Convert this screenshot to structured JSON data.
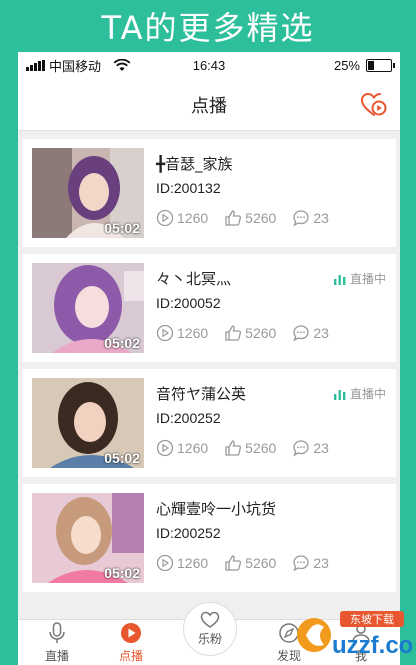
{
  "banner": {
    "text": "TA的更多精选"
  },
  "status_bar": {
    "carrier": "中国移动",
    "time": "16:43",
    "battery": "25%"
  },
  "nav": {
    "title": "点播",
    "icon": "heart-play-icon"
  },
  "colors": {
    "accent": "#e8572f",
    "brand": "#2dbe9c",
    "live": "#2dbe9c",
    "stat_gray": "#9a9a9a"
  },
  "videos": [
    {
      "name": "╋音瑟_家族",
      "id": "ID:200132",
      "duration": "05:02",
      "plays": "1260",
      "likes": "5260",
      "comments": "23",
      "live": ""
    },
    {
      "name": "々丶北冥灬",
      "id": "ID:200052",
      "duration": "05:02",
      "plays": "1260",
      "likes": "5260",
      "comments": "23",
      "live": "直播中"
    },
    {
      "name": "音符ヤ蒲公英",
      "id": "ID:200252",
      "duration": "05:02",
      "plays": "1260",
      "likes": "5260",
      "comments": "23",
      "live": "直播中"
    },
    {
      "name": "心輝壹呤一小坑货",
      "id": "ID:200252",
      "duration": "05:02",
      "plays": "1260",
      "likes": "5260",
      "comments": "23",
      "live": ""
    }
  ],
  "tabs": [
    {
      "label": "直播",
      "icon": "microphone-icon"
    },
    {
      "label": "点播",
      "icon": "play-circle-icon"
    },
    {
      "label": "乐粉",
      "icon": "heart-icon"
    },
    {
      "label": "发现",
      "icon": "discover-icon"
    },
    {
      "label": "我",
      "icon": "person-icon"
    }
  ],
  "watermark": {
    "text": "uzzf.com",
    "sub": "东坡下载"
  }
}
